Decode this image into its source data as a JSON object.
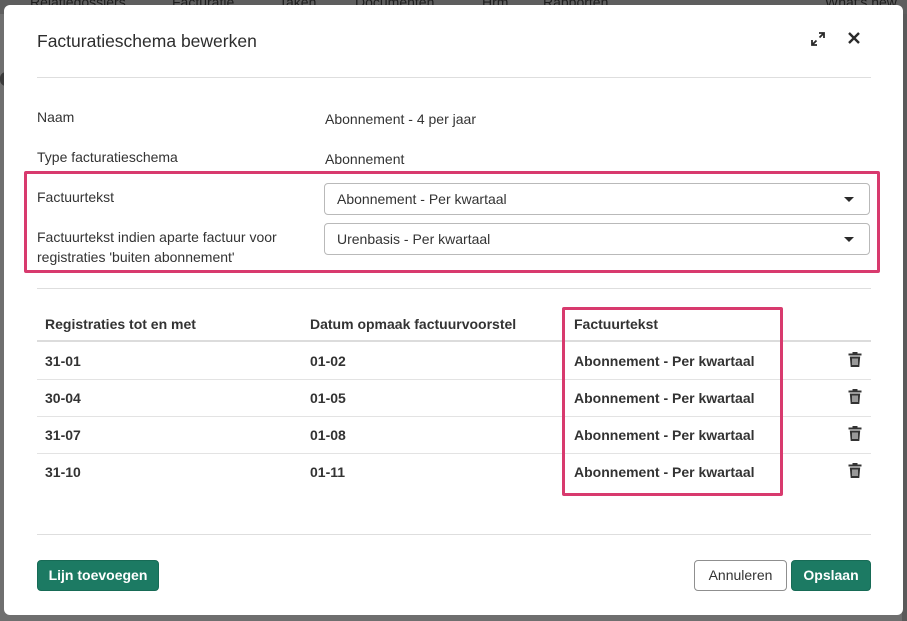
{
  "background_nav": {
    "items": [
      "Relatiedossiers",
      "Facturatie",
      "Taken",
      "Documenten",
      "Hrm",
      "Rapporten"
    ],
    "right": "What's new"
  },
  "modal": {
    "title": "Facturatieschema bewerken"
  },
  "fields": {
    "naam": {
      "label": "Naam",
      "value": "Abonnement - 4 per jaar"
    },
    "type": {
      "label": "Type facturatieschema",
      "value": "Abonnement"
    },
    "factuurtekst": {
      "label": "Factuurtekst",
      "selected": "Abonnement - Per kwartaal"
    },
    "factuurtekst_apart": {
      "label_line1": "Factuurtekst indien aparte factuur voor",
      "label_line2": "registraties 'buiten abonnement'",
      "selected": "Urenbasis - Per kwartaal"
    }
  },
  "table": {
    "headers": [
      "Registraties tot en met",
      "Datum opmaak factuurvoorstel",
      "Factuurtekst"
    ],
    "rows": [
      {
        "tot_en_met": "31-01",
        "datum": "01-02",
        "factuurtekst": "Abonnement - Per kwartaal"
      },
      {
        "tot_en_met": "30-04",
        "datum": "01-05",
        "factuurtekst": "Abonnement - Per kwartaal"
      },
      {
        "tot_en_met": "31-07",
        "datum": "01-08",
        "factuurtekst": "Abonnement - Per kwartaal"
      },
      {
        "tot_en_met": "31-10",
        "datum": "01-11",
        "factuurtekst": "Abonnement - Per kwartaal"
      }
    ]
  },
  "buttons": {
    "add_line": "Lijn toevoegen",
    "cancel": "Annuleren",
    "save": "Opslaan"
  },
  "colors": {
    "primary": "#1c7a63",
    "highlight": "#d83a6e"
  }
}
